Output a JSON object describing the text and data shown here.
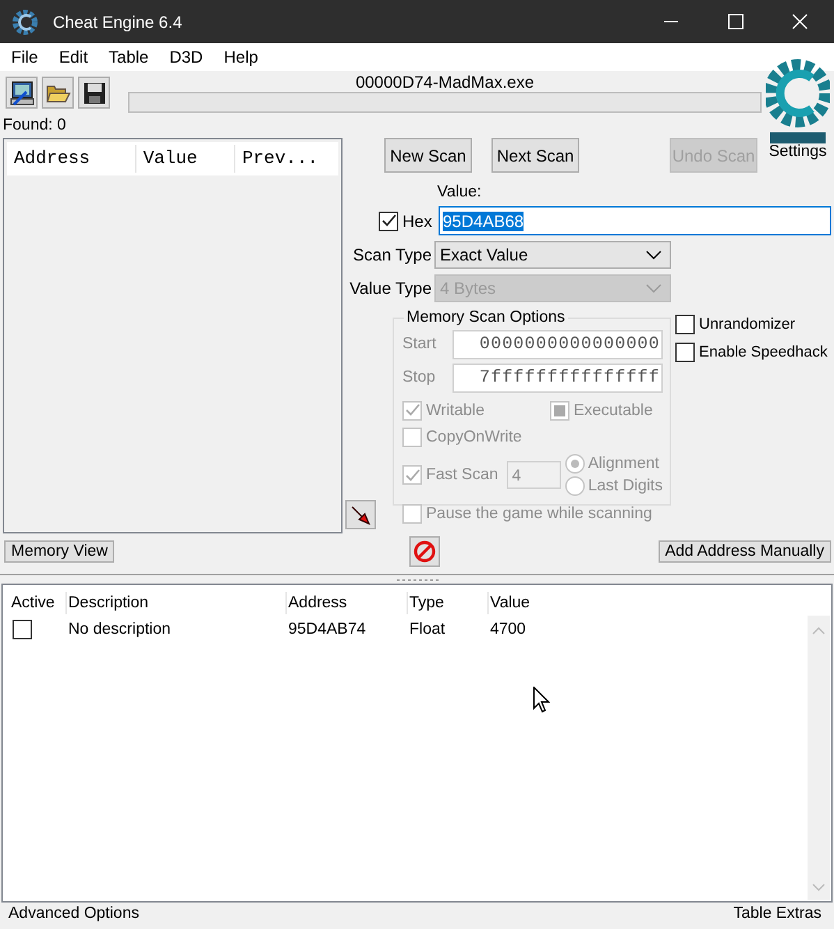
{
  "window": {
    "title": "Cheat Engine 6.4"
  },
  "menu": [
    "File",
    "Edit",
    "Table",
    "D3D",
    "Help"
  ],
  "process": {
    "name": "00000D74-MadMax.exe",
    "level": 0
  },
  "found": "Found: 0",
  "results": {
    "columns": [
      "Address",
      "Value",
      "Prev..."
    ]
  },
  "scan_buttons": [
    {
      "label": "New Scan",
      "disabled": false
    },
    {
      "label": "Next Scan",
      "disabled": false
    },
    {
      "label": "Undo Scan",
      "disabled": true
    }
  ],
  "settings": "Settings",
  "value": {
    "label": "Value:",
    "hex": {
      "label": "Hex",
      "checked": true
    },
    "input": "95D4AB68",
    "text_selected": true
  },
  "scan_type": {
    "label": "Scan Type",
    "value": "Exact Value",
    "disabled": false
  },
  "value_type": {
    "label": "Value Type",
    "value": "4 Bytes",
    "disabled": true
  },
  "memory_scan_options": {
    "title": "Memory Scan Options",
    "disabled": true,
    "start": {
      "label": "Start",
      "value": "0000000000000000"
    },
    "stop": {
      "label": "Stop",
      "value": "7fffffffffffffff"
    },
    "writable": {
      "label": "Writable",
      "checked": true
    },
    "executable": {
      "label": "Executable",
      "checked": false,
      "indeterminate": true
    },
    "copy_on_write": {
      "label": "CopyOnWrite",
      "checked": false,
      "indeterminate": false
    },
    "fast_scan": {
      "label": "Fast Scan",
      "checked": true,
      "value": "4"
    },
    "alignment": [
      {
        "label": "Alignment",
        "selected": true
      },
      {
        "label": "Last Digits",
        "selected": false
      }
    ],
    "pause": {
      "label": "Pause the game while scanning",
      "checked": false
    }
  },
  "extras": [
    {
      "label": "Unrandomizer",
      "checked": false
    },
    {
      "label": "Enable Speedhack",
      "checked": false
    }
  ],
  "memory_view": "Memory View",
  "add_address": "Add Address Manually",
  "cheat_table": {
    "columns": [
      "Active",
      "Description",
      "Address",
      "Type",
      "Value"
    ],
    "rows": [
      {
        "active": false,
        "description": "No description",
        "address": "95D4AB74",
        "type": "Float",
        "value": "4700"
      }
    ]
  },
  "status_bar": {
    "left": "Advanced Options",
    "right": "Table Extras"
  }
}
